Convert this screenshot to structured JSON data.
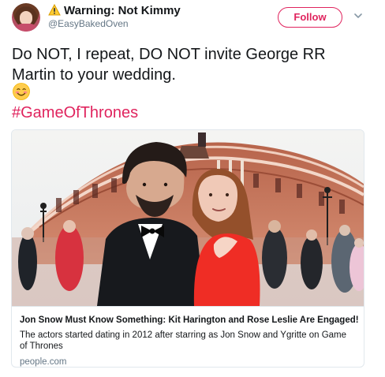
{
  "author": {
    "display_name": "Warning: Not Kimmy",
    "handle": "@EasyBakedOven"
  },
  "follow_button": {
    "label": "Follow"
  },
  "tweet": {
    "text_line_1": "Do NOT, I repeat, DO NOT invite George RR",
    "text_line_2": "Martin to your wedding.",
    "emoji": "smiling-face-with-smiling-eyes",
    "hashtag": "#GameOfThrones"
  },
  "card": {
    "title": "Jon Snow Must Know Something: Kit Harington and Rose Leslie Are Engaged!",
    "description": "The actors started dating in 2012 after starring as Jon Snow and Ygritte on Game of Thrones",
    "domain": "people.com"
  },
  "icons": {
    "warning": "warning-icon",
    "chevron": "chevron-down-icon",
    "emoji": "smiling-face-emoji-icon"
  },
  "colors": {
    "accent": "#e0245e",
    "text": "#14171a",
    "secondary_text": "#657786",
    "border": "#e1e8ed"
  }
}
